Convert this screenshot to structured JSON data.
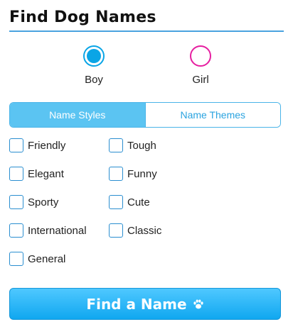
{
  "header": {
    "title": "Find Dog Names"
  },
  "gender": {
    "selected": "Boy",
    "options": [
      {
        "label": "Boy",
        "color": "#0aa5e6"
      },
      {
        "label": "Girl",
        "color": "#e61ea0"
      }
    ]
  },
  "tabs": [
    {
      "label": "Name Styles",
      "active": true
    },
    {
      "label": "Name Themes",
      "active": false
    }
  ],
  "styles": [
    {
      "label": "Friendly",
      "checked": false
    },
    {
      "label": "Tough",
      "checked": false
    },
    {
      "label": "Elegant",
      "checked": false
    },
    {
      "label": "Funny",
      "checked": false
    },
    {
      "label": "Sporty",
      "checked": false
    },
    {
      "label": "Cute",
      "checked": false
    },
    {
      "label": "International",
      "checked": false
    },
    {
      "label": "Classic",
      "checked": false
    },
    {
      "label": "General",
      "checked": false
    }
  ],
  "action": {
    "label": "Find a Name",
    "icon": "paw-icon"
  },
  "colors": {
    "accent": "#4ab4e8",
    "button": "#10a7f0"
  }
}
